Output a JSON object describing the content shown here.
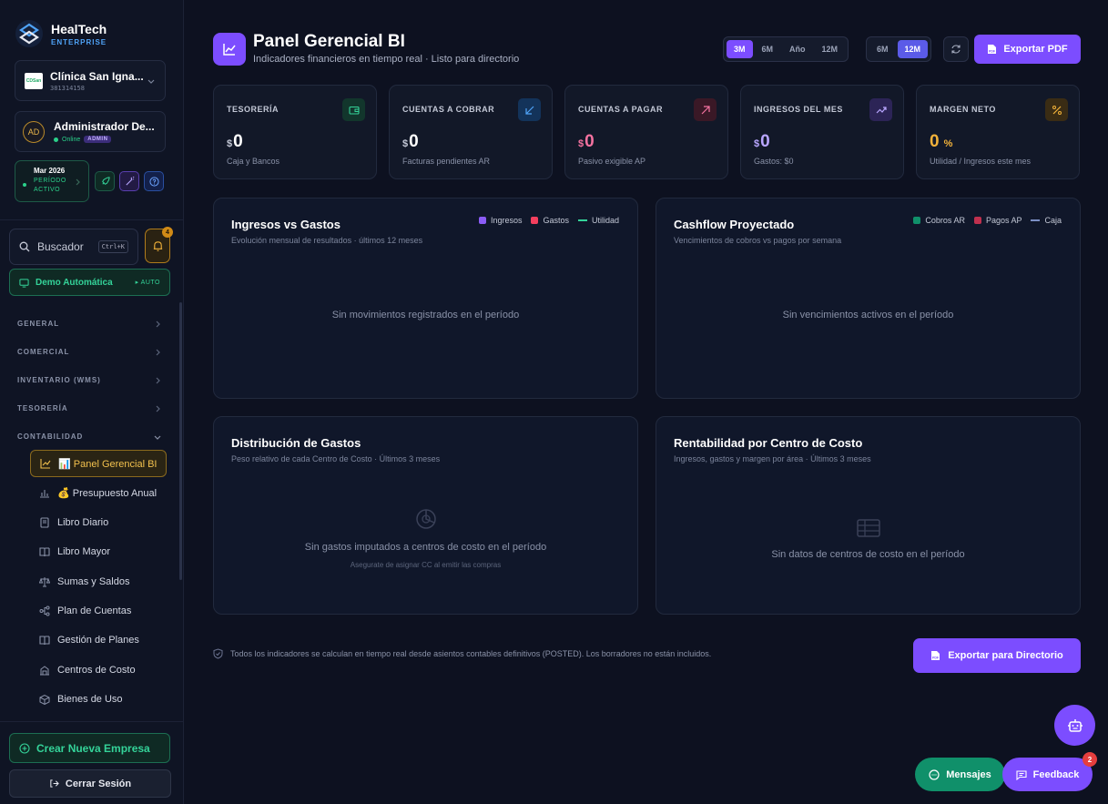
{
  "brand": {
    "name": "HealTech",
    "sub": "ENTERPRISE"
  },
  "company": {
    "name": "Clínica San Igna...",
    "id": "381314158",
    "logo_text": "CDSan"
  },
  "user": {
    "initials": "AD",
    "name": "Administrador De...",
    "status": "Online",
    "role": "ADMIN"
  },
  "period": {
    "month": "Mar 2026",
    "state": "PERÍODO ACTIVO"
  },
  "search": {
    "label": "Buscador",
    "shortcut": "Ctrl+K"
  },
  "notifications": {
    "count": "4"
  },
  "demo": {
    "label": "Demo Automática",
    "auto": "▸ AUTO"
  },
  "nav": {
    "sections": [
      "GENERAL",
      "COMERCIAL",
      "INVENTARIO (WMS)",
      "TESORERÍA",
      "CONTABILIDAD"
    ],
    "items": [
      {
        "label": "📊 Panel Gerencial BI",
        "icon": "chart-line-icon"
      },
      {
        "label": "💰 Presupuesto Anual",
        "icon": "bar-chart-icon"
      },
      {
        "label": "Libro Diario",
        "icon": "journal-icon"
      },
      {
        "label": "Libro Mayor",
        "icon": "book-icon"
      },
      {
        "label": "Sumas y Saldos",
        "icon": "scale-icon"
      },
      {
        "label": "Plan de Cuentas",
        "icon": "tree-icon"
      },
      {
        "label": "Gestión de Planes",
        "icon": "book-open-icon"
      },
      {
        "label": "Centros de Costo",
        "icon": "building-icon"
      },
      {
        "label": "Bienes de Uso",
        "icon": "box-icon"
      }
    ]
  },
  "sidebar_bottom": {
    "create": "Crear Nueva Empresa",
    "logout": "Cerrar Sesión"
  },
  "header": {
    "title": "Panel Gerencial BI",
    "subtitle": "Indicadores financieros en tiempo real · Listo para directorio",
    "range_a": [
      "3M",
      "6M",
      "Año",
      "12M"
    ],
    "range_b": [
      "6M",
      "12M"
    ],
    "export": "Exportar PDF"
  },
  "kpis": [
    {
      "label": "TESORERÍA",
      "currency": "$",
      "value": "0",
      "sub": "Caja y Bancos",
      "color": "#ffffff",
      "icon": "wallet-icon"
    },
    {
      "label": "CUENTAS A COBRAR",
      "currency": "$",
      "value": "0",
      "sub": "Facturas pendientes AR",
      "color": "#ffffff",
      "icon": "arrow-down-left-icon"
    },
    {
      "label": "CUENTAS A PAGAR",
      "currency": "$",
      "value": "0",
      "sub": "Pasivo exigible AP",
      "color": "#f472a0",
      "icon": "arrow-up-right-icon"
    },
    {
      "label": "INGRESOS DEL MES",
      "currency": "$",
      "value": "0",
      "sub": "Gastos: $0",
      "color": "#b9a6ff",
      "icon": "trending-up-icon"
    },
    {
      "label": "MARGEN NETO",
      "currency": "",
      "value": "0",
      "unit": "%",
      "sub": "Utilidad / Ingresos este mes",
      "color": "#f2b23a",
      "icon": "percent-icon"
    }
  ],
  "panels": {
    "income": {
      "title": "Ingresos vs Gastos",
      "sub": "Evolución mensual de resultados · últimos 12 meses",
      "legend": [
        "Ingresos",
        "Gastos",
        "Utilidad"
      ],
      "empty": "Sin movimientos registrados en el período"
    },
    "cashflow": {
      "title": "Cashflow Proyectado",
      "sub": "Vencimientos de cobros vs pagos por semana",
      "legend": [
        "Cobros AR",
        "Pagos AP",
        "Caja"
      ],
      "empty": "Sin vencimientos activos en el período"
    },
    "distribution": {
      "title": "Distribución de Gastos",
      "sub": "Peso relativo de cada Centro de Costo · Últimos 3 meses",
      "empty": "Sin gastos imputados a centros de costo en el período",
      "empty_sub": "Asegurate de asignar CC al emitir las compras"
    },
    "profit": {
      "title": "Rentabilidad por Centro de Costo",
      "sub": "Ingresos, gastos y margen por área · Últimos 3 meses",
      "empty": "Sin datos de centros de costo en el período"
    }
  },
  "footer": {
    "note": "Todos los indicadores se calculan en tiempo real desde asientos contables definitivos (POSTED). Los borradores no están incluidos.",
    "export_dir": "Exportar para Directorio"
  },
  "floating": {
    "messages": "Mensajes",
    "feedback": "Feedback",
    "feedback_count": "2"
  },
  "colors": {
    "accent": "#7c4dff",
    "success": "#34d399",
    "warning": "#f2b23a",
    "danger": "#e53e5a"
  }
}
